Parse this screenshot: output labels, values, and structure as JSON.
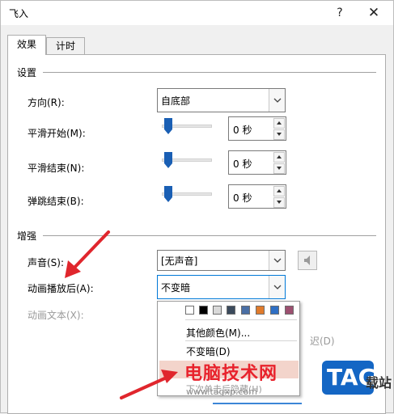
{
  "window": {
    "title": "飞入",
    "help": "?",
    "close": "✕"
  },
  "tabs": [
    {
      "label": "效果"
    },
    {
      "label": "计时"
    }
  ],
  "settings": {
    "group_label": "设置",
    "direction": {
      "label": "方向(R):",
      "value": "自底部"
    },
    "smooth_start": {
      "label": "平滑开始(M):",
      "value": "0 秒"
    },
    "smooth_end": {
      "label": "平滑结束(N):",
      "value": "0 秒"
    },
    "bounce_end": {
      "label": "弹跳结束(B):",
      "value": "0 秒"
    }
  },
  "enhance": {
    "group_label": "增强",
    "sound": {
      "label": "声音(S):",
      "value": "[无声音]"
    },
    "after_animation": {
      "label": "动画播放后(A):",
      "value": "不变暗"
    },
    "animate_text": {
      "label": "动画文本(X):"
    },
    "delay_partial": "迟(D)"
  },
  "dropdown": {
    "swatches": [
      "#ffffff",
      "#000000",
      "#d9d9d9",
      "#3b4a5c",
      "#4a6fa5",
      "#e07b2c",
      "#2f6fc4",
      "#9c5070"
    ],
    "more_colors": "其他颜色(M)...",
    "no_dim": "不变暗(D)",
    "hide_next": "下次单击后隐藏(H)"
  },
  "watermark": {
    "text": "电脑技术网",
    "url": "www.tagxp.com",
    "logo": "TAG",
    "side": "载站"
  },
  "colors": {
    "annotation_arrow": "#e0262d",
    "highlight": "#f3d4cb",
    "focus": "#0078d7"
  }
}
